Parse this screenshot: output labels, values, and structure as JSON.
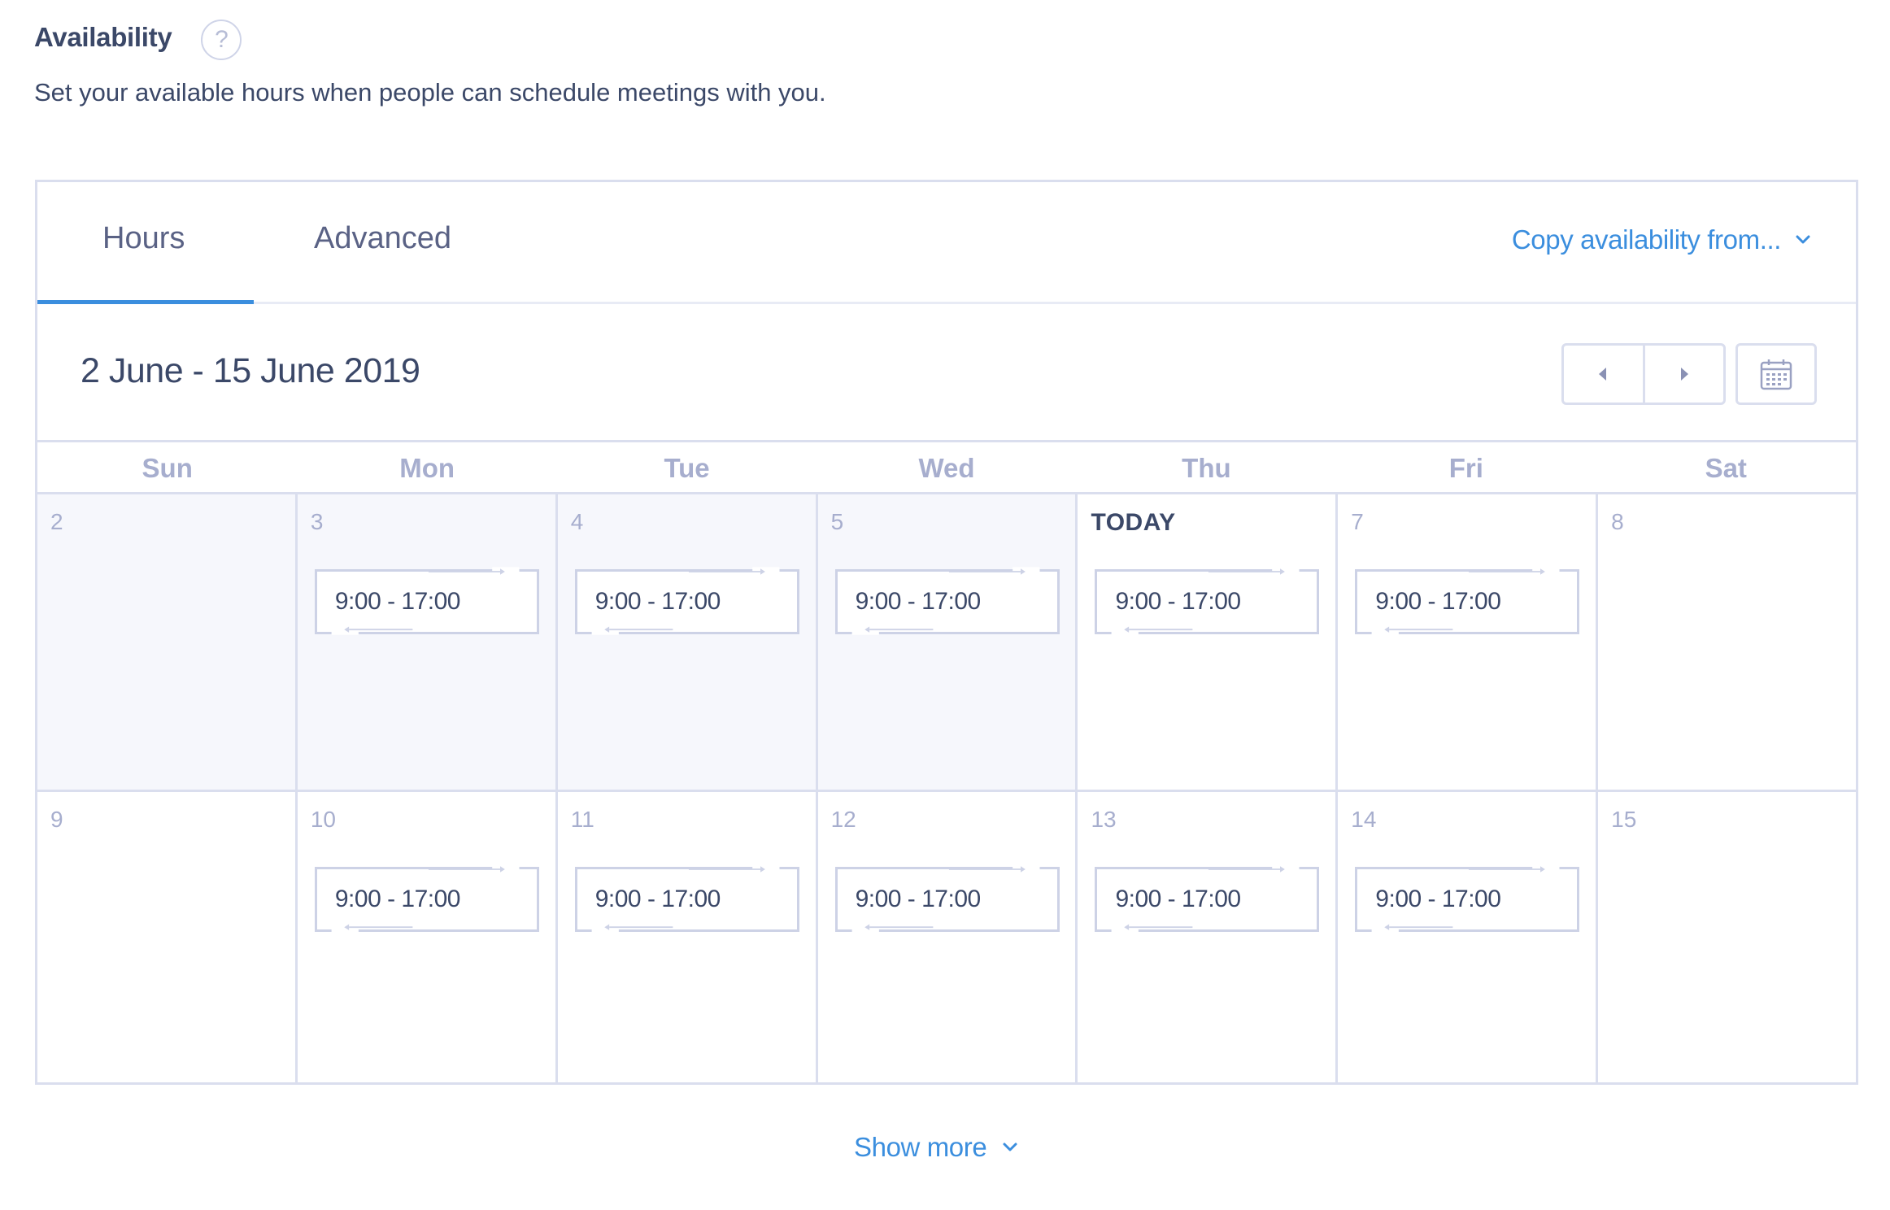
{
  "header": {
    "title": "Availability",
    "help_icon_glyph": "?",
    "subtitle": "Set your available hours when people can schedule meetings with you."
  },
  "tabs": [
    {
      "label": "Hours",
      "active": true
    },
    {
      "label": "Advanced",
      "active": false
    }
  ],
  "copy_availability": {
    "label": "Copy availability from...",
    "icon": "chevron-down-icon"
  },
  "range": {
    "label": "2 June - 15 June 2019"
  },
  "nav": {
    "prev_icon": "caret-left-icon",
    "next_icon": "caret-right-icon",
    "calendar_icon": "calendar-icon"
  },
  "weekdays": [
    "Sun",
    "Mon",
    "Tue",
    "Wed",
    "Thu",
    "Fri",
    "Sat"
  ],
  "weeks": [
    [
      {
        "day": "2",
        "slot": "",
        "past": true
      },
      {
        "day": "3",
        "slot": "9:00 - 17:00",
        "past": true
      },
      {
        "day": "4",
        "slot": "9:00 - 17:00",
        "past": true
      },
      {
        "day": "5",
        "slot": "9:00 - 17:00",
        "past": true
      },
      {
        "day": "TODAY",
        "slot": "9:00 - 17:00",
        "past": false,
        "today": true
      },
      {
        "day": "7",
        "slot": "9:00 - 17:00",
        "past": false
      },
      {
        "day": "8",
        "slot": "",
        "past": false
      }
    ],
    [
      {
        "day": "9",
        "slot": "",
        "past": false
      },
      {
        "day": "10",
        "slot": "9:00 - 17:00",
        "past": false
      },
      {
        "day": "11",
        "slot": "9:00 - 17:00",
        "past": false
      },
      {
        "day": "12",
        "slot": "9:00 - 17:00",
        "past": false
      },
      {
        "day": "13",
        "slot": "9:00 - 17:00",
        "past": false
      },
      {
        "day": "14",
        "slot": "9:00 - 17:00",
        "past": false
      },
      {
        "day": "15",
        "slot": "",
        "past": false
      }
    ]
  ],
  "show_more": {
    "label": "Show more",
    "icon": "chevron-down-icon"
  },
  "colors": {
    "accent": "#3b8ede",
    "text": "#3b4868",
    "muted": "#a7aece",
    "border": "#dadeee",
    "past_bg": "#f6f7fc"
  }
}
